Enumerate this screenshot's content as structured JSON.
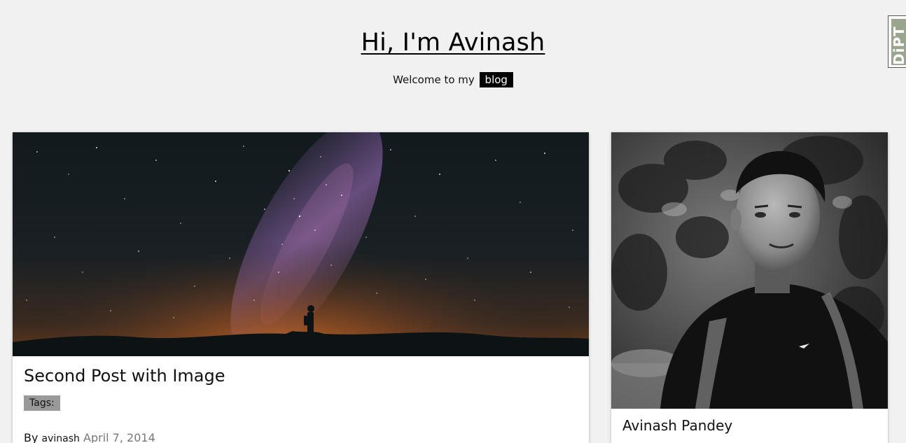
{
  "header": {
    "title": "Hi, I'm Avinash",
    "tagline_prefix": "Welcome to my",
    "tagline_badge": "blog"
  },
  "corner_badge": {
    "text": "DiPT"
  },
  "post": {
    "title": "Second Post with Image",
    "tags_label": "Tags:",
    "byline_prefix": "By",
    "author": "avinash",
    "date": "April 7, 2014",
    "image": "milky-way-silhouette-image"
  },
  "profile": {
    "name": "Avinash Pandey",
    "image": "profile-photo-image"
  },
  "colors": {
    "page_background": "#f1f1f1",
    "card_background": "#ffffff",
    "badge_background": "#000000",
    "tag_chip_background": "#999999",
    "date_text": "#777777"
  }
}
